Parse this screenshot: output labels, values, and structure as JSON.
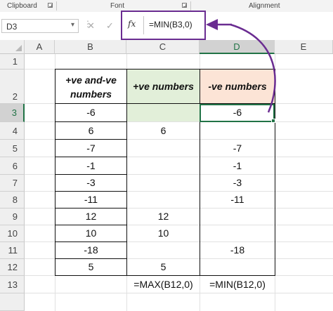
{
  "ribbon": {
    "clipboard": "Clipboard",
    "font": "Font",
    "alignment": "Alignment"
  },
  "formula_bar": {
    "name_box": "D3",
    "fx": "fx",
    "formula": "=MIN(B3,0)",
    "cancel_icon": "✕",
    "enter_icon": "✓"
  },
  "columns": [
    "A",
    "B",
    "C",
    "D",
    "E"
  ],
  "rows": [
    "1",
    "2",
    "3",
    "4",
    "5",
    "6",
    "7",
    "8",
    "9",
    "10",
    "11",
    "12",
    "13"
  ],
  "table": {
    "headers": {
      "b": "+ve and-ve numbers",
      "c": "+ve numbers",
      "d": "-ve numbers"
    },
    "header_colors": {
      "c": "#e2efd9",
      "d": "#fce4d6"
    },
    "values": [
      {
        "b": "-6",
        "c": "",
        "d": "-6"
      },
      {
        "b": "6",
        "c": "6",
        "d": ""
      },
      {
        "b": "-7",
        "c": "",
        "d": "-7"
      },
      {
        "b": "-1",
        "c": "",
        "d": "-1"
      },
      {
        "b": "-3",
        "c": "",
        "d": "-3"
      },
      {
        "b": "-11",
        "c": "",
        "d": "-11"
      },
      {
        "b": "12",
        "c": "12",
        "d": ""
      },
      {
        "b": "10",
        "c": "10",
        "d": ""
      },
      {
        "b": "-18",
        "c": "",
        "d": "-18"
      },
      {
        "b": "5",
        "c": "5",
        "d": ""
      }
    ],
    "formulas": {
      "c": "=MAX(B12,0)",
      "d": "=MIN(B12,0)"
    }
  },
  "colors": {
    "accent": "#217346",
    "annotation": "#6a2c91"
  }
}
